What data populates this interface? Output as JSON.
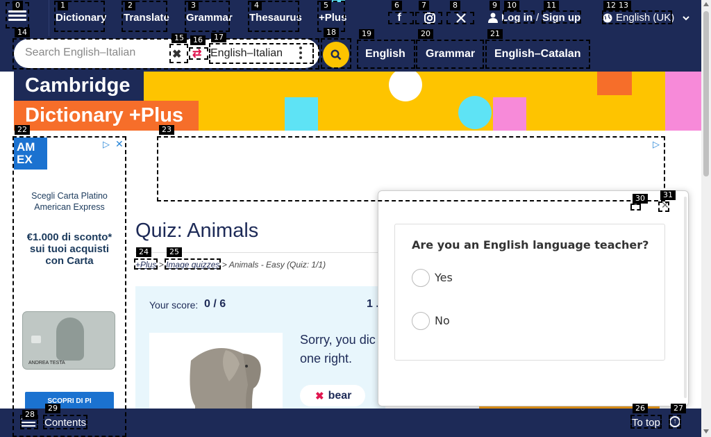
{
  "nav": {
    "links": [
      "Dictionary",
      "Translate",
      "Grammar",
      "Thesaurus",
      "+Plus"
    ],
    "social_icons": [
      "facebook-icon",
      "instagram-icon",
      "x-icon"
    ],
    "login": "Log in",
    "separator": "/",
    "signup": "Sign up",
    "language": "English (UK)"
  },
  "search": {
    "placeholder": "Search English–Italian",
    "dictionary": "English–Italian",
    "quick_links": [
      "English",
      "Grammar",
      "English–Catalan"
    ]
  },
  "banner": {
    "line1": "Cambridge",
    "line2": "Dictionary +Plus"
  },
  "ad": {
    "logo": "AM\nEX",
    "headline": "Scegli Carta Platino American Express",
    "offer": "€1.000 di sconto* sui tuoi acquisti con Carta",
    "card_name": "ANDREA TESTA",
    "cta": "SCOPRI DI PI"
  },
  "quiz": {
    "title": "Quiz: Animals",
    "breadcrumb": {
      "plus": "+Plus",
      "sep1": ">",
      "image_quizzes": "Image quizzes",
      "sep2": ">",
      "current": "Animals - Easy (Quiz: 1/1)"
    },
    "score_label": "Your score:",
    "score_value": "0 / 6",
    "progress": "1 .",
    "feedback_line1": "Sorry, you dic",
    "feedback_line2": "one right.",
    "answer": "bear"
  },
  "survey": {
    "question": "Are you an English language teacher?",
    "options": [
      "Yes",
      "No"
    ]
  },
  "footer": {
    "contents": "Contents",
    "to_top": "To top"
  },
  "annotations": [
    "0",
    "1",
    "2",
    "3",
    "4",
    "5",
    "6",
    "7",
    "8",
    "9",
    "10",
    "11",
    "12",
    "13",
    "14",
    "15",
    "16",
    "17",
    "18",
    "19",
    "20",
    "21",
    "22",
    "23",
    "24",
    "25",
    "26",
    "27",
    "28",
    "29",
    "30",
    "31"
  ],
  "colors": {
    "navy": "#1d2a57",
    "yellow": "#fec400",
    "orange": "#f66e2a",
    "pink_swap": "#e0164f",
    "quiz_bg": "#e8f6fc"
  }
}
